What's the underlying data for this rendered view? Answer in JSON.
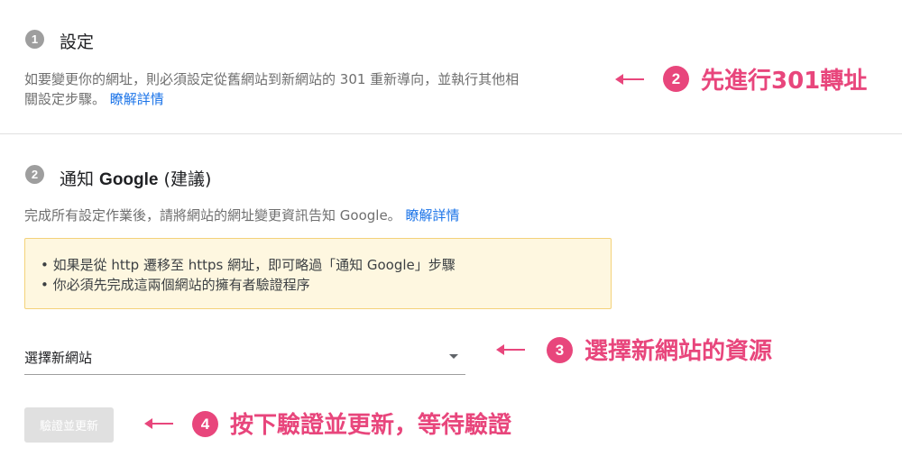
{
  "section1": {
    "badge": "1",
    "title": "設定",
    "desc_line1": "如要變更你的網址，則必須設定從舊網站到新網站的 301 重新導向，並執行其他相",
    "desc_line2": "關設定步驟。",
    "learn_more": "瞭解詳情"
  },
  "section2": {
    "badge": "2",
    "title_prefix": "通知 ",
    "title_brand": "Google",
    "title_suffix": " (建議)",
    "desc": "完成所有設定作業後，請將網站的網址變更資訊告知 Google。",
    "learn_more": "瞭解詳情",
    "notice": [
      "• 如果是從 http 遷移至 https 網址，即可略過「通知 Google」步驟",
      "• 你必須先完成這兩個網站的擁有者驗證程序"
    ],
    "select": {
      "value": "選擇新網站",
      "caret_icon": "dropdown-triangle"
    },
    "verify_button": "驗證並更新"
  },
  "annotations": [
    {
      "number": "2",
      "text": "先進行301轉址"
    },
    {
      "number": "3",
      "text": "選擇新網站的資源"
    },
    {
      "number": "4",
      "text": "按下驗證並更新，等待驗證"
    }
  ],
  "colors": {
    "annotation": "#e8467c",
    "link": "#1a73e8",
    "notice_bg": "#fef7e0",
    "notice_border": "#f4d27a",
    "step_badge": "#9e9e9e",
    "disabled_button": "#e0e0e0"
  }
}
